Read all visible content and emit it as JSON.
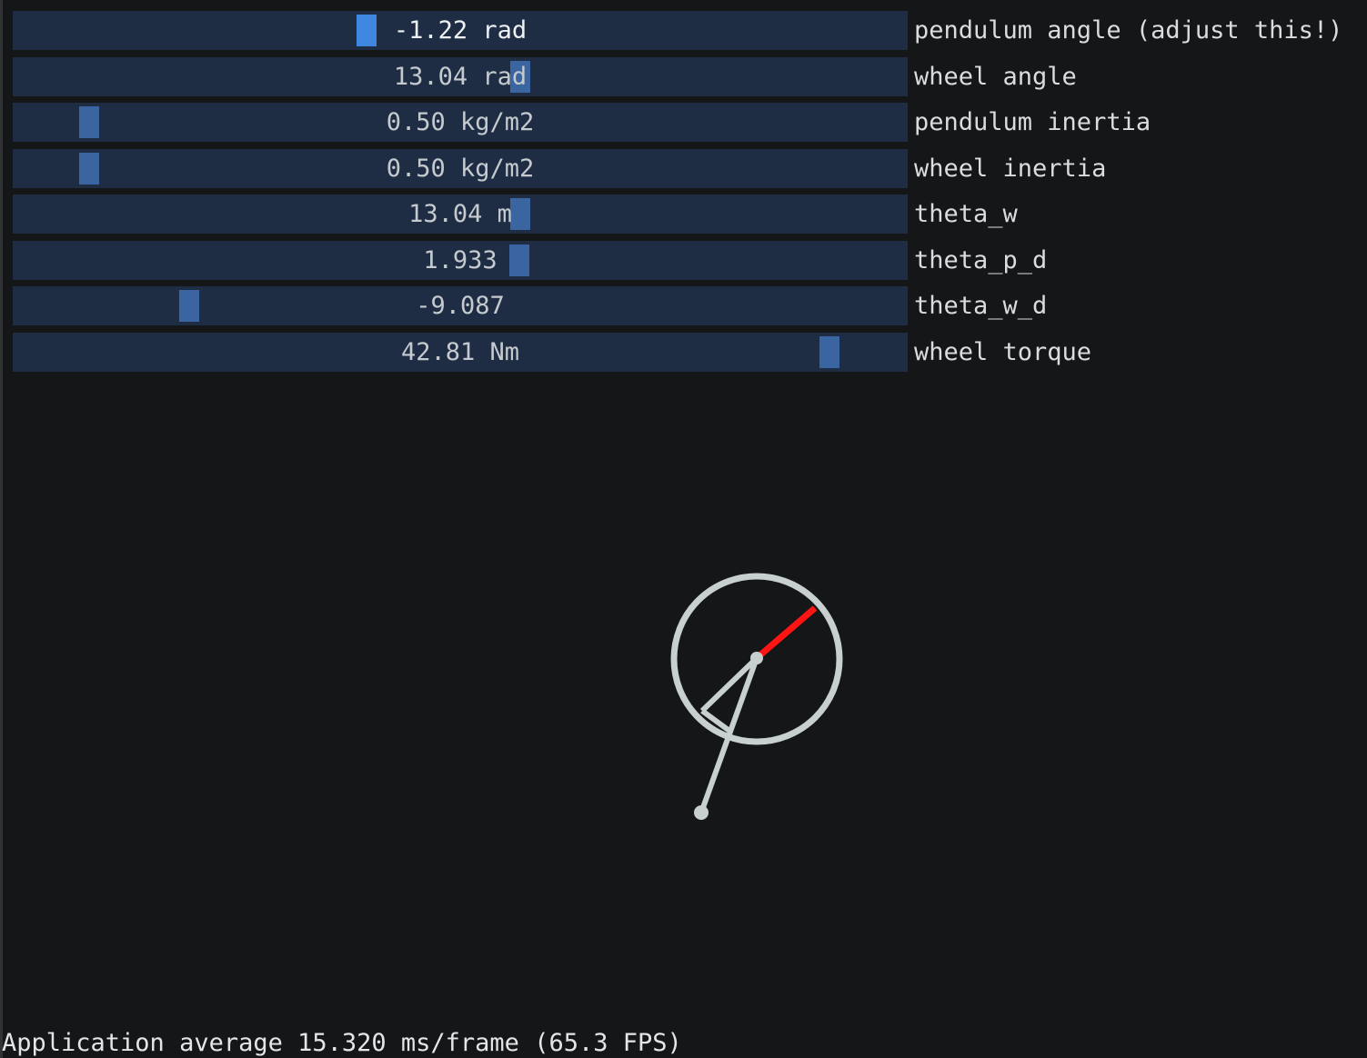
{
  "sliders": [
    {
      "value_text": "-1.22 rad",
      "label": "pendulum angle (adjust this!)",
      "fraction": 0.395,
      "active": true
    },
    {
      "value_text": "13.04 rad",
      "label": "wheel angle",
      "fraction": 0.567,
      "active": false
    },
    {
      "value_text": "0.50 kg/m2",
      "label": "pendulum inertia",
      "fraction": 0.085,
      "active": false
    },
    {
      "value_text": "0.50 kg/m2",
      "label": "wheel inertia",
      "fraction": 0.085,
      "active": false
    },
    {
      "value_text": "13.04 m",
      "label": "theta_w",
      "fraction": 0.567,
      "active": false
    },
    {
      "value_text": "1.933",
      "label": "theta_p_d",
      "fraction": 0.566,
      "active": false
    },
    {
      "value_text": "-9.087",
      "label": "theta_w_d",
      "fraction": 0.197,
      "active": false
    },
    {
      "value_text": "42.81 Nm",
      "label": "wheel torque",
      "fraction": 0.913,
      "active": false
    }
  ],
  "status": {
    "fps_text": "Application average 15.320 ms/frame (65.3 FPS)"
  },
  "colors": {
    "background": "#151618",
    "slider_track": "#1e2d44",
    "slider_grab": "#3a65a1",
    "slider_grab_active": "#3f86e0",
    "scene_stroke": "#c8cfcf",
    "wheel_marker": "#ff1414"
  }
}
